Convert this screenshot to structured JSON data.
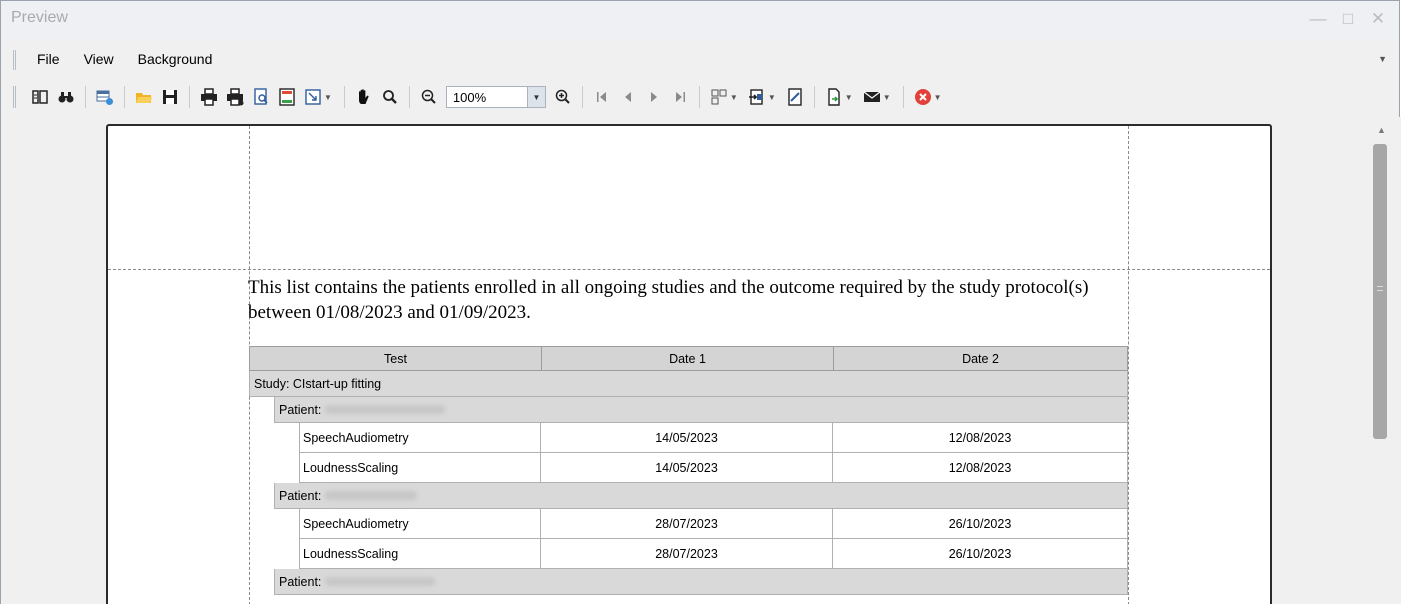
{
  "window": {
    "title": "Preview"
  },
  "menu": {
    "items": [
      "File",
      "View",
      "Background"
    ]
  },
  "toolbar": {
    "zoom_value": "100%"
  },
  "report": {
    "intro": "This list contains the patients enrolled in all ongoing studies and the outcome required by the study protocol(s) between 01/08/2023 and 01/09/2023.",
    "columns": [
      "Test",
      "Date 1",
      "Date 2"
    ],
    "study_label": "Study: CIstart-up fitting",
    "patient_label": "Patient:",
    "patients": [
      {
        "rows": [
          {
            "test": "SpeechAudiometry",
            "date1": "14/05/2023",
            "date2": "12/08/2023"
          },
          {
            "test": "LoudnessScaling",
            "date1": "14/05/2023",
            "date2": "12/08/2023"
          }
        ]
      },
      {
        "rows": [
          {
            "test": "SpeechAudiometry",
            "date1": "28/07/2023",
            "date2": "26/10/2023"
          },
          {
            "test": "LoudnessScaling",
            "date1": "28/07/2023",
            "date2": "26/10/2023"
          }
        ]
      },
      {
        "rows": []
      }
    ]
  }
}
